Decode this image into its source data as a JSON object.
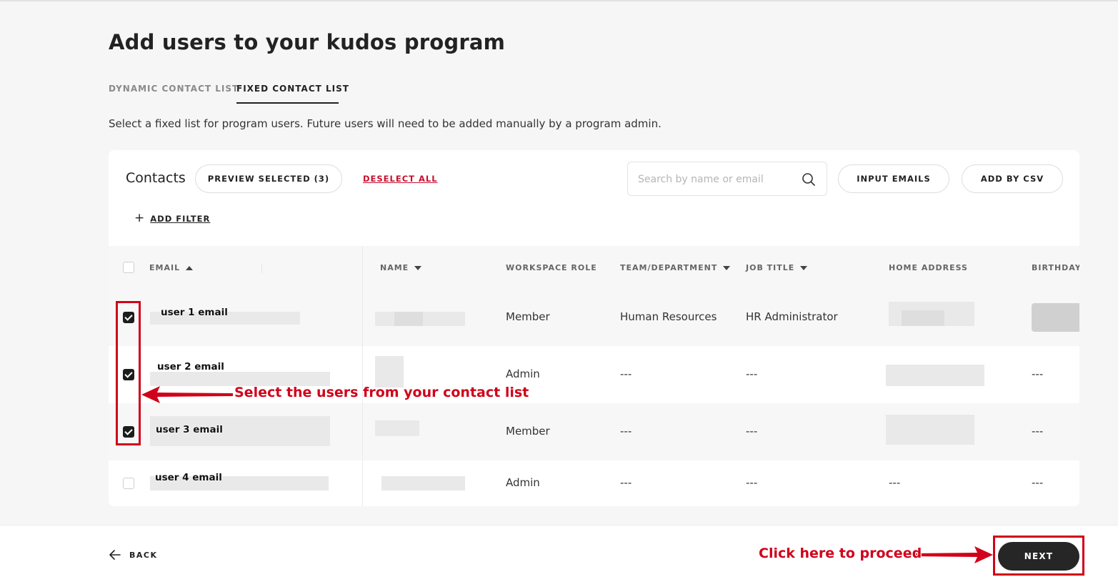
{
  "page": {
    "title": "Add users to your kudos program",
    "description": "Select a fixed list for program users. Future users will need to be added manually by a program admin."
  },
  "tabs": [
    {
      "label": "DYNAMIC CONTACT LIST",
      "active": false
    },
    {
      "label": "FIXED CONTACT LIST",
      "active": true
    }
  ],
  "contacts": {
    "title": "Contacts",
    "preview_selected_label": "PREVIEW SELECTED (3)",
    "deselect_all_label": "DESELECT ALL",
    "search_placeholder": "Search by name or email",
    "input_emails_label": "INPUT EMAILS",
    "add_by_csv_label": "ADD BY CSV",
    "add_filter_label": "ADD FILTER"
  },
  "table": {
    "columns": [
      {
        "label": "EMAIL",
        "sort": "asc"
      },
      {
        "label": "NAME",
        "sort": "desc"
      },
      {
        "label": "WORKSPACE ROLE",
        "sort": null
      },
      {
        "label": "TEAM/DEPARTMENT",
        "sort": "desc"
      },
      {
        "label": "JOB TITLE",
        "sort": "desc"
      },
      {
        "label": "HOME ADDRESS",
        "sort": null
      },
      {
        "label": "BIRTHDAY",
        "sort": null
      }
    ],
    "rows": [
      {
        "email_label": "user 1 email",
        "checked": true,
        "role": "Member",
        "team": "Human Resources",
        "job": "HR Administrator",
        "address": "",
        "birthday": ""
      },
      {
        "email_label": "user 2 email",
        "checked": true,
        "role": "Admin",
        "team": "---",
        "job": "---",
        "address": "",
        "birthday": "---"
      },
      {
        "email_label": "user 3 email",
        "checked": true,
        "role": "Member",
        "team": "---",
        "job": "---",
        "address": "",
        "birthday": "---"
      },
      {
        "email_label": "user 4 email",
        "checked": false,
        "role": "Admin",
        "team": "---",
        "job": "---",
        "address": "---",
        "birthday": "---"
      }
    ]
  },
  "footer": {
    "back_label": "BACK",
    "next_label": "NEXT"
  },
  "annotations": {
    "select_users": "Select the users from your contact list",
    "proceed": "Click here to proceed",
    "color": "#d0021b"
  }
}
